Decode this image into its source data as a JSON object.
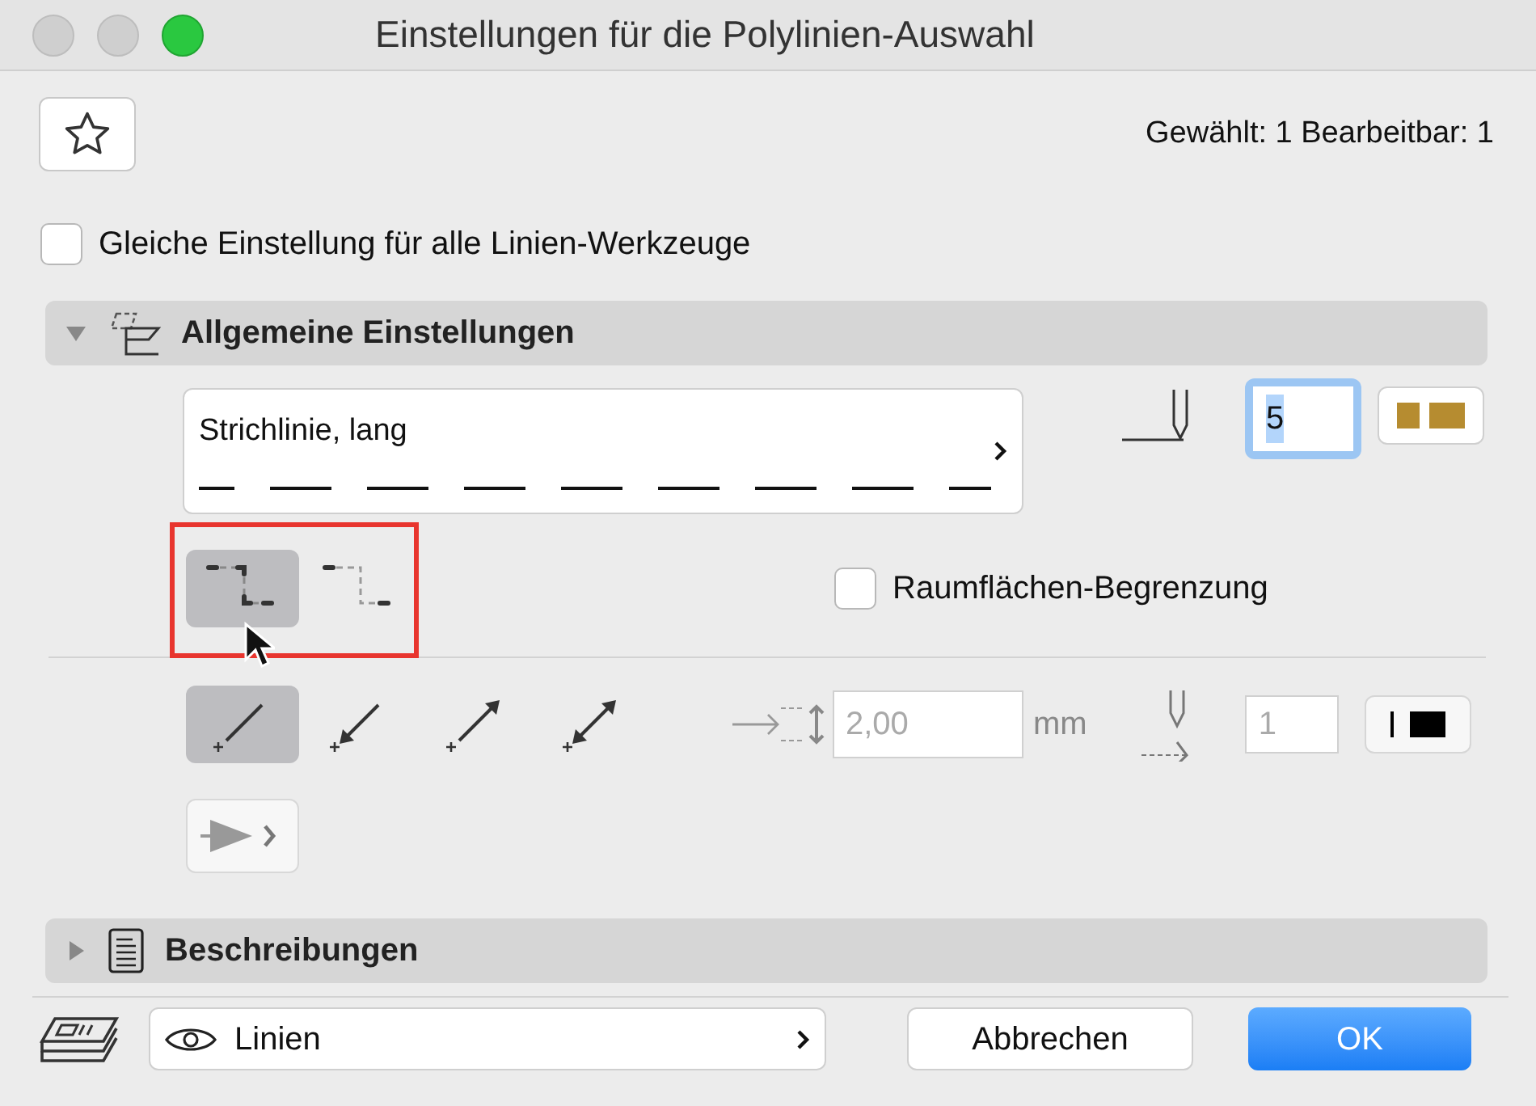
{
  "window": {
    "title": "Einstellungen für die Polylinien-Auswahl"
  },
  "selection_info": "Gewählt: 1 Bearbeitbar: 1",
  "same_settings": {
    "label": "Gleiche Einstellung für alle Linien-Werkzeuge",
    "checked": false
  },
  "sections": [
    {
      "title": "Allgemeine Einstellungen",
      "expanded": true
    },
    {
      "title": "Beschreibungen",
      "expanded": false
    }
  ],
  "line_type": {
    "name": "Strichlinie, lang"
  },
  "pen": {
    "value": "5"
  },
  "corner_modes": [
    {
      "kind": "solid",
      "selected": true
    },
    {
      "kind": "dashed",
      "selected": false
    }
  ],
  "room_boundary": {
    "label": "Raumflächen-Begrenzung",
    "checked": false
  },
  "arrow_modes": [
    {
      "kind": "none",
      "selected": true
    },
    {
      "kind": "start",
      "selected": false
    },
    {
      "kind": "end",
      "selected": false
    },
    {
      "kind": "both",
      "selected": false
    }
  ],
  "arrow_size": {
    "value": "2,00",
    "unit": "mm",
    "disabled": true
  },
  "arrow_pen": {
    "value": "1",
    "disabled": true
  },
  "layer": {
    "value": "Linien"
  },
  "buttons": [
    {
      "label": "Abbrechen",
      "kind": "secondary"
    },
    {
      "label": "OK",
      "kind": "primary"
    }
  ]
}
